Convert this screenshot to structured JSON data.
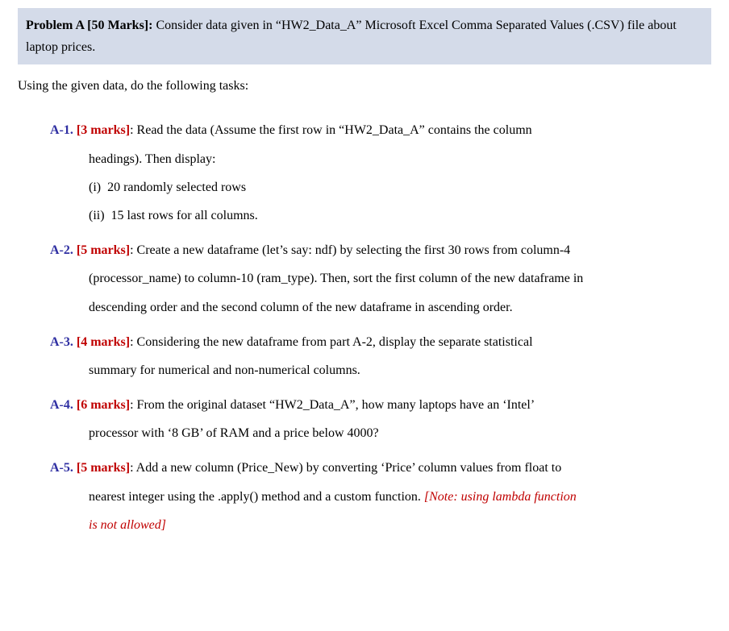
{
  "header": {
    "title_bold": "Problem A [50 Marks]:",
    "title_rest": " Consider data given in “HW2_Data_A” Microsoft Excel Comma Separated Values (.CSV) file about laptop prices."
  },
  "intro": "Using the given data, do the following tasks:",
  "tasks": [
    {
      "num": "A-1.",
      "marks": "[3 marks]",
      "text_first": ": Read the data (Assume the first row in “HW2_Data_A” contains the column",
      "text_cont": [
        "headings). Then display:"
      ],
      "subitems": [
        "(i)  20 randomly selected rows",
        "(ii)  15 last rows for all columns."
      ]
    },
    {
      "num": "A-2.",
      "marks": "[5 marks]",
      "text_first": ": Create a new dataframe (let’s say: ndf) by selecting the first 30 rows from column-4",
      "text_cont": [
        "(processor_name) to column-10 (ram_type). Then, sort the first column of the new dataframe in",
        "descending order and the second column of the new dataframe in ascending order."
      ]
    },
    {
      "num": "A-3.",
      "marks": "[4 marks]",
      "text_first": ": Considering the new dataframe from part A-2, display the separate statistical",
      "text_cont": [
        "summary for numerical and non-numerical columns."
      ]
    },
    {
      "num": "A-4.",
      "marks": "[6 marks]",
      "text_first": ": From the original dataset “HW2_Data_A”, how many laptops have an ‘Intel’",
      "text_cont": [
        "processor with ‘8 GB’ of RAM and a price below 4000?"
      ]
    },
    {
      "num": "A-5.",
      "marks": "[5 marks]",
      "text_first": ": Add a new column (Price_New) by converting ‘Price’ column values from float to",
      "text_cont": [
        "nearest integer using the .apply() method and a custom function. "
      ],
      "note_inline": "[Note: using lambda function",
      "note_cont": "is not allowed]"
    }
  ]
}
